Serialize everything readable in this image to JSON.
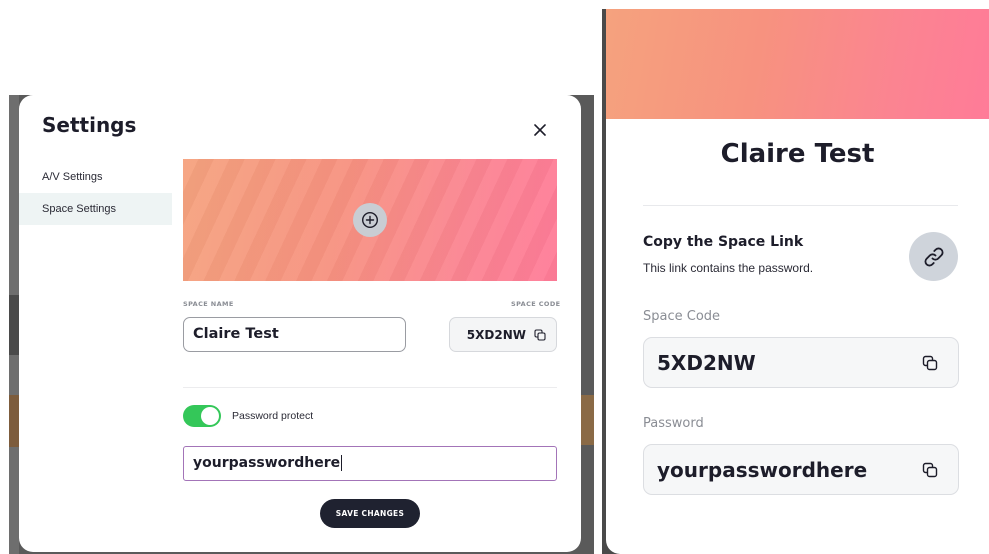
{
  "settings_modal": {
    "title": "Settings",
    "close_icon": "close-icon",
    "nav": [
      {
        "label": "A/V Settings",
        "active": false
      },
      {
        "label": "Space Settings",
        "active": true
      }
    ],
    "banner": {
      "add_icon": "plus-circle-icon"
    },
    "space_name_label": "SPACE NAME",
    "space_name_value": "Claire Test",
    "space_code_label": "SPACE CODE",
    "space_code_value": "5XD2NW",
    "copy_icon": "copy-icon",
    "password_protect": {
      "label": "Password protect",
      "enabled": true
    },
    "password_value": "yourpasswordhere",
    "save_label": "SAVE CHANGES"
  },
  "space_panel": {
    "title": "Claire Test",
    "copy_link_title": "Copy the Space Link",
    "copy_link_subtitle": "This link contains the password.",
    "link_icon": "link-icon",
    "space_code_label": "Space Code",
    "space_code_value": "5XD2NW",
    "password_label": "Password",
    "password_value": "yourpasswordhere"
  },
  "colors": {
    "banner_start": "#f5a27e",
    "banner_end": "#ff7b98",
    "toggle_on": "#34c759",
    "save_button": "#1f2230",
    "password_focus_border": "#a374b8"
  }
}
